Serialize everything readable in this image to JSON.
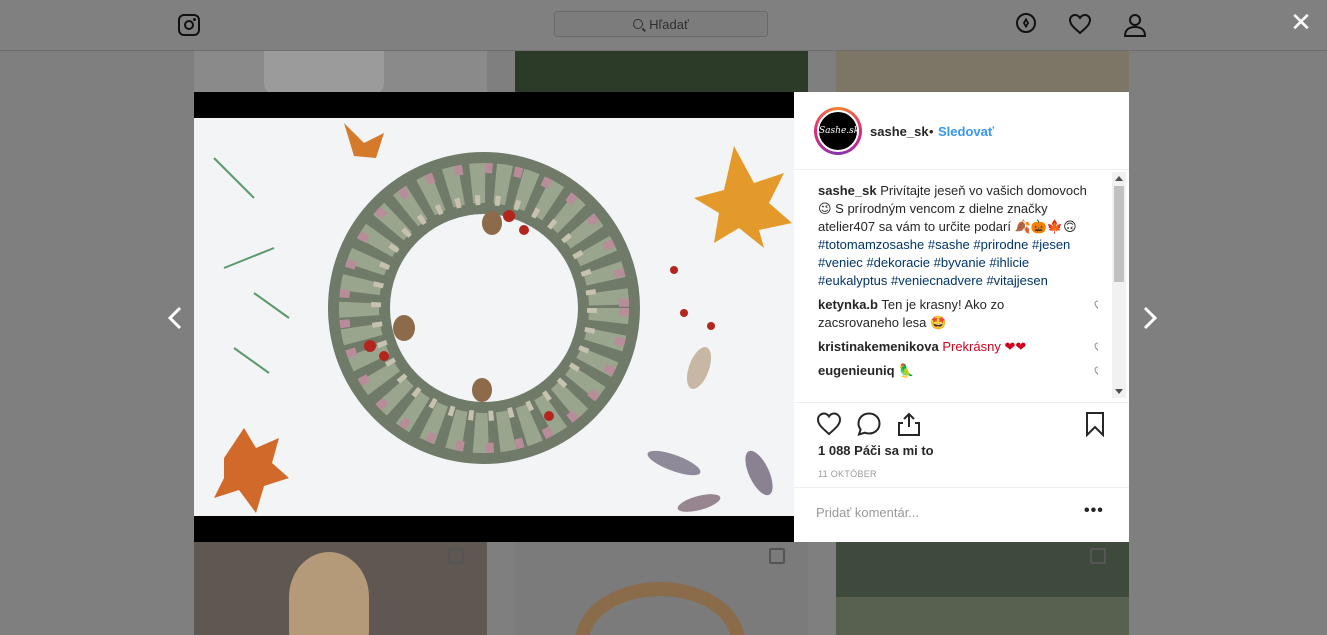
{
  "colors": {
    "accent": "#3897f0",
    "hashtag": "#003569",
    "text": "#262626",
    "muted": "#999999",
    "overlay": "rgba(0,0,0,0.5)"
  },
  "header": {
    "logo_icon": "instagram-icon",
    "search_placeholder": "Hľadať",
    "icons": [
      "compass-icon",
      "heart-icon",
      "person-icon"
    ]
  },
  "overlay": {
    "close_icon": "close-icon",
    "prev_icon": "chevron-left-icon",
    "next_icon": "chevron-right-icon"
  },
  "post": {
    "username": "sashe_sk",
    "avatar_text": "Sashe.sk",
    "follow_label": "Sledovať",
    "caption": {
      "user": "sashe_sk",
      "text": "Privítajte jeseň vo vašich domovoch 😉 S prírodným vencom z dielne značky atelier407 sa vám to určite podarí 🍂🎃🍁🙃",
      "hashtags": [
        "#totomamzosashe",
        "#sashe",
        "#prirodne",
        "#jesen",
        "#veniec",
        "#dekoracie",
        "#byvanie",
        "#ihlicie",
        "#eukalyptus",
        "#veniecnadvere",
        "#vitajjesen"
      ]
    },
    "comments": [
      {
        "user": "ketynka.b",
        "text": "Ten je krasny! Ako zo zacsrovaneho lesa 🤩"
      },
      {
        "user": "kristinakemenikova",
        "text": "Prekrásny ❤❤"
      },
      {
        "user": "eugenieuniq",
        "text": "🦜"
      }
    ],
    "likes_text": "1 088 Páči sa mi to",
    "date": "11 OKTÓBER",
    "add_comment_placeholder": "Pridať komentár...",
    "more_label": "•••"
  }
}
